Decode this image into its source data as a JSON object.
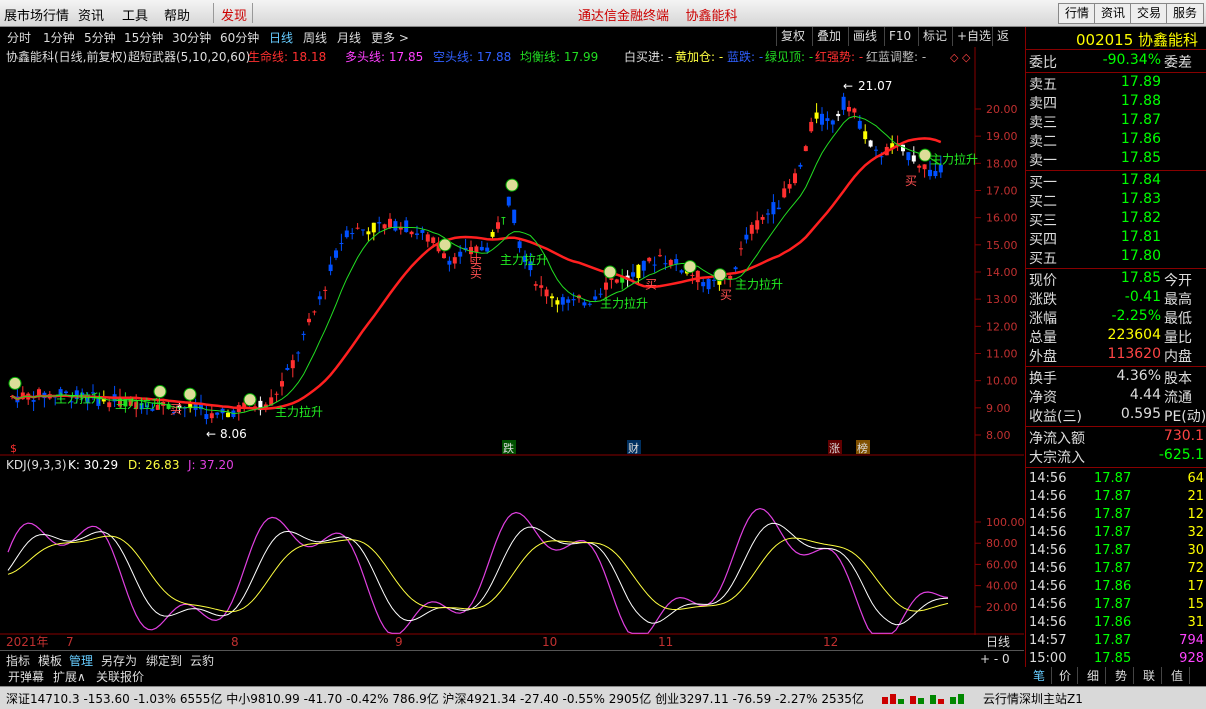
{
  "menu": {
    "items": [
      "展市场行情",
      "资讯",
      "工具",
      "帮助"
    ],
    "discover": "发现",
    "center_title": "通达信金融终端    协鑫能科",
    "right_buttons": [
      "行情",
      "资讯",
      "交易",
      "服务"
    ]
  },
  "periods": {
    "items": [
      "分时",
      "1分钟",
      "5分钟",
      "15分钟",
      "30分钟",
      "60分钟",
      "日线",
      "周线",
      "月线",
      "更多 >"
    ],
    "active": "日线"
  },
  "toolbar": {
    "items": [
      "复权",
      "叠加",
      "画线",
      "F10",
      "标记",
      "+自选",
      "返回"
    ]
  },
  "chart": {
    "header": {
      "name": "协鑫能科(日线,前复权)",
      "indicator": "超短武器(5,10,20,60)",
      "life_label": "生命线: 18.18",
      "long_label": "多头线: 17.85",
      "empty_label": "空头线: 17.88",
      "balance_label": "均衡线: 17.99",
      "buy_label": "白买进: -",
      "add_label": "黄加仓: -",
      "blue_label": "蓝跌: -",
      "green_label": "绿见顶: -",
      "red_label": "红强势: -",
      "adjust_label": "红蓝调整: -"
    },
    "price_ticks": [
      "20.00",
      "19.00",
      "18.00",
      "17.00",
      "16.00",
      "15.00",
      "14.00",
      "13.00",
      "12.00",
      "11.00",
      "10.00",
      "9.00",
      "8.00"
    ],
    "annotations": {
      "high": "21.07",
      "low": "8.06",
      "buy": "买",
      "rise": "主力拉升",
      "rise_top": "主力拉升",
      "cash": "$",
      "events": [
        "跌",
        "财",
        "涨",
        "榜"
      ]
    },
    "kdj_header": {
      "name": "KDJ(9,3,3)",
      "k": "K: 30.29",
      "d": "D: 26.83",
      "j": "J: 37.20"
    },
    "kdj_ticks": [
      "100.00",
      "80.00",
      "60.00",
      "40.00",
      "20.00"
    ],
    "x_labels": [
      "2021年",
      "7",
      "8",
      "9",
      "10",
      "11",
      "12"
    ],
    "period_label": "日线",
    "zoom": "+ - 0"
  },
  "right": {
    "code_title": "002015 协鑫能科",
    "weibi": {
      "label": "委比",
      "value": "-90.34%",
      "right": "委差"
    },
    "sell": [
      {
        "label": "卖五",
        "price": "17.89"
      },
      {
        "label": "卖四",
        "price": "17.88"
      },
      {
        "label": "卖三",
        "price": "17.87"
      },
      {
        "label": "卖二",
        "price": "17.86"
      },
      {
        "label": "卖一",
        "price": "17.85"
      }
    ],
    "buy": [
      {
        "label": "买一",
        "price": "17.84"
      },
      {
        "label": "买二",
        "price": "17.83"
      },
      {
        "label": "买三",
        "price": "17.82"
      },
      {
        "label": "买四",
        "price": "17.81"
      },
      {
        "label": "买五",
        "price": "17.80"
      }
    ],
    "stats": [
      {
        "label": "现价",
        "value": "17.85",
        "right": "今开",
        "color": "#0f0"
      },
      {
        "label": "涨跌",
        "value": "-0.41",
        "right": "最高",
        "color": "#0f0"
      },
      {
        "label": "涨幅",
        "value": "-2.25%",
        "right": "最低",
        "color": "#0f0"
      },
      {
        "label": "总量",
        "value": "223604",
        "right": "量比",
        "color": "#ff0"
      },
      {
        "label": "外盘",
        "value": "113620",
        "right": "内盘",
        "color": "#f44"
      }
    ],
    "stats2": [
      {
        "label": "换手",
        "value": "4.36%",
        "right": "股本",
        "color": "#ddd"
      },
      {
        "label": "净资",
        "value": "4.44",
        "right": "流通",
        "color": "#ddd"
      },
      {
        "label": "收益(三)",
        "value": "0.595",
        "right": "PE(动)",
        "color": "#ddd"
      }
    ],
    "flow": [
      {
        "label": "净流入额",
        "value": "730.1",
        "color": "#f44"
      },
      {
        "label": "大宗流入",
        "value": "-625.1",
        "color": "#0f0"
      }
    ],
    "ticks": [
      {
        "time": "14:56",
        "price": "17.87",
        "vol": "64",
        "vc": "#ff0"
      },
      {
        "time": "14:56",
        "price": "17.87",
        "vol": "21",
        "vc": "#ff0"
      },
      {
        "time": "14:56",
        "price": "17.87",
        "vol": "12",
        "vc": "#ff0"
      },
      {
        "time": "14:56",
        "price": "17.87",
        "vol": "32",
        "vc": "#ff0"
      },
      {
        "time": "14:56",
        "price": "17.87",
        "vol": "30",
        "vc": "#ff0"
      },
      {
        "time": "14:56",
        "price": "17.87",
        "vol": "72",
        "vc": "#ff0"
      },
      {
        "time": "14:56",
        "price": "17.86",
        "vol": "17",
        "vc": "#ff0"
      },
      {
        "time": "14:56",
        "price": "17.87",
        "vol": "15",
        "vc": "#ff0"
      },
      {
        "time": "14:56",
        "price": "17.86",
        "vol": "31",
        "vc": "#ff0"
      },
      {
        "time": "14:57",
        "price": "17.87",
        "vol": "794",
        "vc": "#f4f"
      },
      {
        "time": "15:00",
        "price": "17.85",
        "vol": "928",
        "vc": "#f4f"
      }
    ],
    "tabs": [
      "笔",
      "价",
      "细",
      "势",
      "联",
      "值"
    ]
  },
  "bottom": {
    "tabs1": [
      "指标",
      "模板",
      "管理",
      "另存为",
      "绑定到",
      "云豹"
    ],
    "tabs2": [
      "开弹幕",
      "扩展∧",
      "关联报价"
    ],
    "status": "深证14710.3 -153.60 -1.03% 6555亿  中小9810.99 -41.70 -0.42% 786.9亿  沪深4921.34 -27.40 -0.55% 2905亿  创业3297.11 -76.59 -2.27% 2535亿",
    "status_right": "云行情深圳主站Z1"
  },
  "colors": {
    "up": "#ff3030",
    "down": "#0050ff",
    "life": "#ff2020",
    "ma": "#22dd22",
    "kdj_j": "#e040e0",
    "kdj_k": "#ffffff",
    "kdj_d": "#ffff40"
  }
}
